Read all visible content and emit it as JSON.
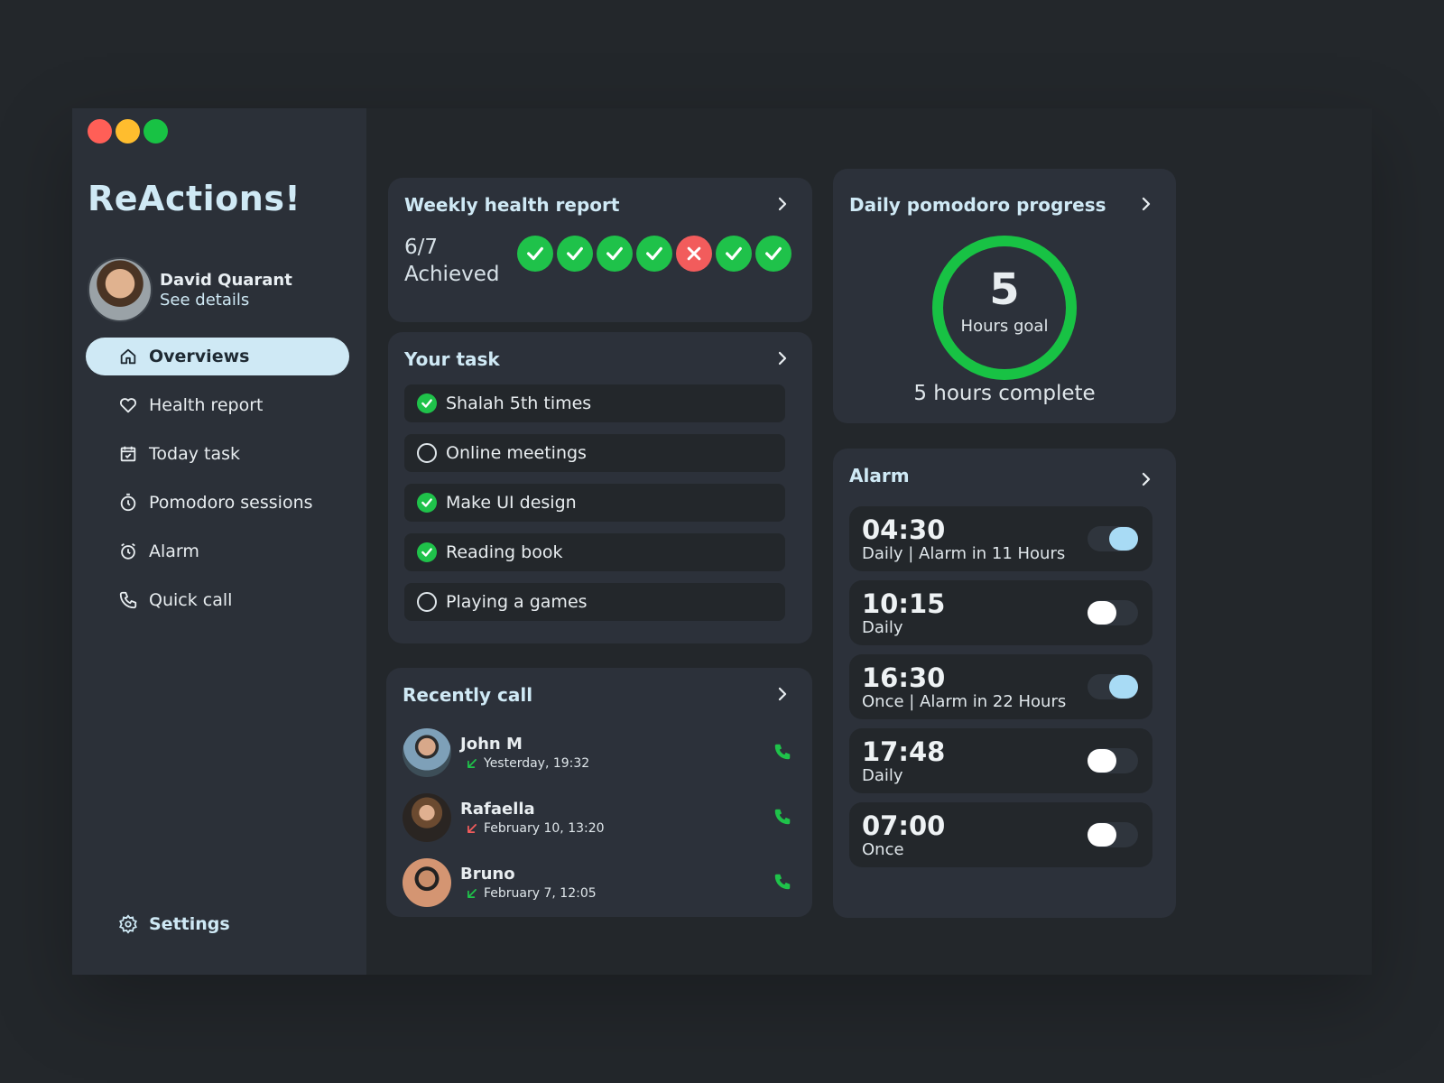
{
  "app": {
    "title": "ReActions!"
  },
  "profile": {
    "name": "David Quarant",
    "link": "See details"
  },
  "nav": {
    "items": [
      {
        "label": "Overviews",
        "icon": "home-icon",
        "active": true
      },
      {
        "label": "Health report",
        "icon": "heart-icon"
      },
      {
        "label": "Today task",
        "icon": "calendar-check-icon"
      },
      {
        "label": "Pomodoro sessions",
        "icon": "stopwatch-icon"
      },
      {
        "label": "Alarm",
        "icon": "alarm-clock-icon"
      },
      {
        "label": "Quick call",
        "icon": "phone-icon"
      }
    ],
    "settings": "Settings"
  },
  "health": {
    "title": "Weekly health report",
    "achieved_count": "6/7",
    "achieved_label": "Achieved",
    "days": [
      true,
      true,
      true,
      true,
      false,
      true,
      true
    ]
  },
  "tasks": {
    "title": "Your task",
    "items": [
      {
        "label": "Shalah 5th times",
        "done": true
      },
      {
        "label": "Online meetings",
        "done": false
      },
      {
        "label": "Make UI design",
        "done": true
      },
      {
        "label": "Reading book",
        "done": true
      },
      {
        "label": "Playing a games",
        "done": false
      }
    ]
  },
  "calls": {
    "title": "Recently call",
    "items": [
      {
        "name": "John M",
        "time": "Yesterday, 19:32",
        "direction": "incoming"
      },
      {
        "name": "Rafaella",
        "time": "February 10, 13:20",
        "direction": "missed"
      },
      {
        "name": "Bruno",
        "time": "February 7, 12:05",
        "direction": "incoming"
      }
    ]
  },
  "pomodoro": {
    "title": "Daily pomodoro progress",
    "value": "5",
    "label": "Hours goal",
    "caption": "5 hours complete",
    "progress": 1.0
  },
  "alarm": {
    "title": "Alarm",
    "items": [
      {
        "time": "04:30",
        "sub": "Daily | Alarm in 11 Hours",
        "on": true
      },
      {
        "time": "10:15",
        "sub": "Daily",
        "on": false
      },
      {
        "time": "16:30",
        "sub": "Once | Alarm in 22 Hours",
        "on": true
      },
      {
        "time": "17:48",
        "sub": "Daily",
        "on": false
      },
      {
        "time": "07:00",
        "sub": "Once",
        "on": false
      }
    ]
  },
  "colors": {
    "accent": "#cfe9f5",
    "success": "#1fc24a",
    "danger": "#f25c5c",
    "toggle_on": "#a8dbf5"
  }
}
